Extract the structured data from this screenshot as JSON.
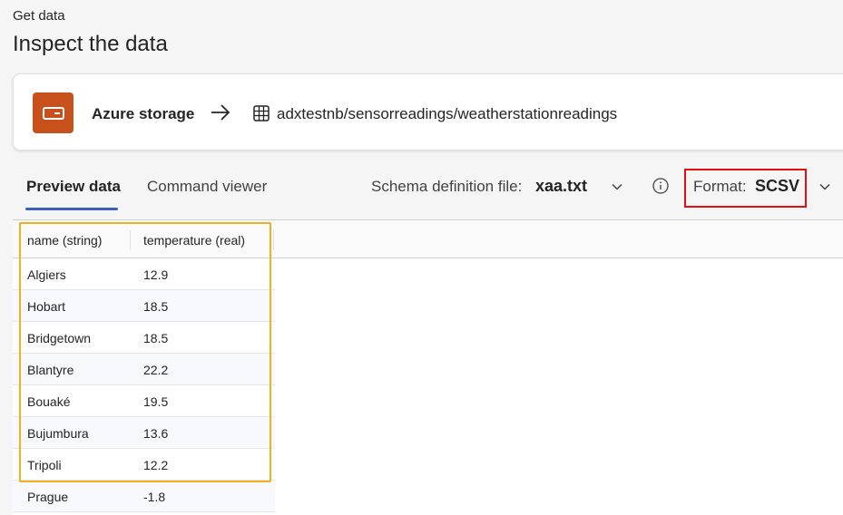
{
  "header": {
    "small": "Get data",
    "title": "Inspect the data"
  },
  "source": {
    "icon": "storage-icon",
    "label": "Azure storage",
    "arrow": "arrow-right-icon",
    "table_icon": "table-icon",
    "path": "adxtestnb/sensorreadings/weatherstationreadings"
  },
  "tabs": [
    {
      "label": "Preview data",
      "selected": true
    },
    {
      "label": "Command viewer",
      "selected": false
    }
  ],
  "schema": {
    "label": "Schema definition file:",
    "value": "xaa.txt"
  },
  "format": {
    "label": "Format:",
    "value": "SCSV"
  },
  "table": {
    "columns": [
      "name (string)",
      "temperature (real)"
    ],
    "rows": [
      [
        "Algiers",
        "12.9"
      ],
      [
        "Hobart",
        "18.5"
      ],
      [
        "Bridgetown",
        "18.5"
      ],
      [
        "Blantyre",
        "22.2"
      ],
      [
        "Bouaké",
        "19.5"
      ],
      [
        "Bujumbura",
        "13.6"
      ],
      [
        "Tripoli",
        "12.2"
      ],
      [
        "Prague",
        "-1.8"
      ]
    ]
  },
  "colors": {
    "accent": "#3a5fbf",
    "storage_icon_bg": "#c8501b",
    "format_highlight": "#e01010",
    "table_highlight": "#f0b020"
  }
}
